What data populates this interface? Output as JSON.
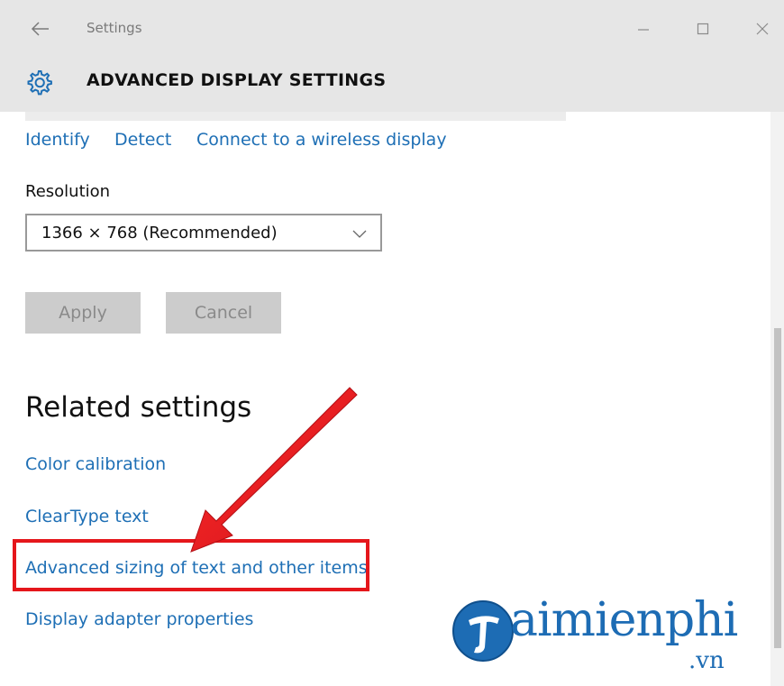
{
  "titlebar": {
    "title": "Settings",
    "back_icon": "back-arrow-icon",
    "controls": [
      "minimize-icon",
      "maximize-icon",
      "close-icon"
    ]
  },
  "header": {
    "icon": "gear-icon",
    "title": "ADVANCED DISPLAY SETTINGS"
  },
  "display_links": {
    "identify": "Identify",
    "detect": "Detect",
    "wireless": "Connect to a wireless display"
  },
  "resolution": {
    "label": "Resolution",
    "selected": "1366 × 768 (Recommended)"
  },
  "buttons": {
    "apply": "Apply",
    "cancel": "Cancel"
  },
  "related": {
    "title": "Related settings",
    "links": [
      "Color calibration",
      "ClearType text",
      "Advanced sizing of text and other items",
      "Display adapter properties"
    ]
  },
  "watermark": {
    "brand": "aimienphi",
    "suffix": ".vn"
  },
  "colors": {
    "accent_link": "#1e6fb5",
    "annotation_red": "#e5161b",
    "watermark_blue": "#1d6cb4"
  }
}
